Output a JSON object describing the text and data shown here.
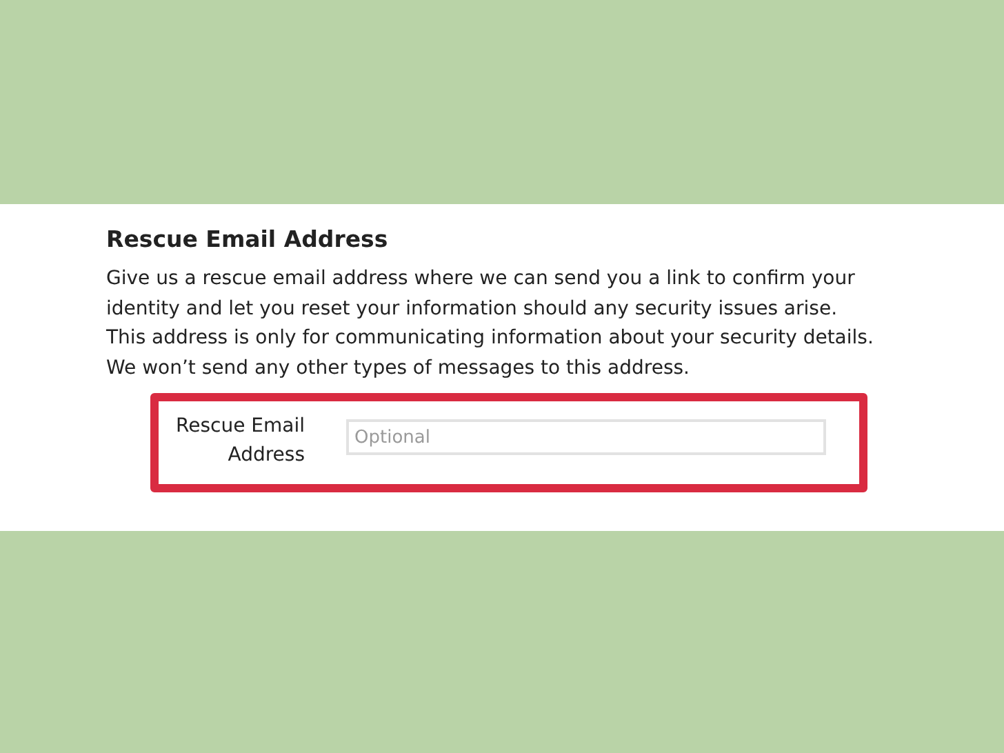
{
  "section": {
    "title": "Rescue Email Address",
    "description": "Give us a rescue email address where we can send you a link to confirm your identity and let you reset your information should any security issues arise. This address is only for communicating information about your security details. We won’t send any other types of messages to this address.",
    "field": {
      "label": "Rescue Email Address",
      "placeholder": "Optional"
    }
  }
}
